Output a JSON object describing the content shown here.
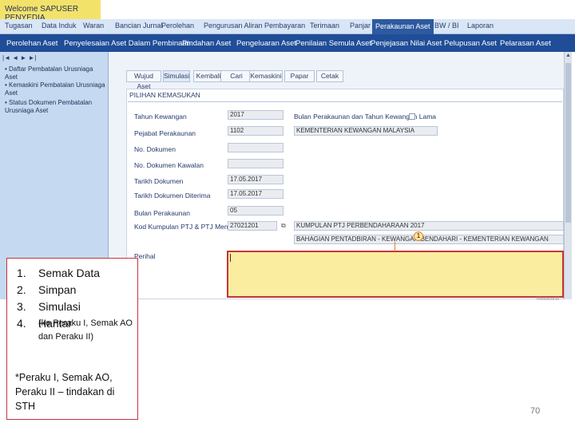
{
  "app": {
    "welcome": "Welcome SAPUSER PENYEDIA"
  },
  "menu": [
    "Tugasan",
    "Data Induk",
    "Waran",
    "Bancian Jurnal",
    "Perolehan",
    "Pengurusan Aliran Pembayaran",
    "Terimaan",
    "Panjar",
    "Perakaunan Aset",
    "BW / BI",
    "Laporan"
  ],
  "submenu": [
    "Perolehan Aset",
    "Penyelesaian Aset Dalam Pembinaan",
    "Pindahan Aset",
    "Pengeluaran Aset",
    "Penilaian Semula Aset",
    "Penjejasan Nilai Aset",
    "Pelupusan Aset",
    "Pelarasan Aset"
  ],
  "sidebar": {
    "controls": "|◄ ◄ ► ►|",
    "links": [
      "Daftar Pembatalan Urusniaga Aset",
      "Kemaskini Pembatalan Urusniaga Aset",
      "Status Dokumen Pembatalan Urusniaga Aset"
    ]
  },
  "tabs": [
    "Wujud Aset",
    "Simulasi",
    "Kembali",
    "Cari",
    "Kemaskini",
    "Papar",
    "Cetak"
  ],
  "panel": {
    "title": "PILIHAN KEMASUKAN",
    "fields": {
      "tahun_kewangan": {
        "label": "Tahun Kewangan",
        "value": "2017"
      },
      "pejabat": {
        "label": "Pejabat Perakaunan",
        "value": "1102",
        "desc": "KEMENTERIAN KEWANGAN MALAYSIA"
      },
      "no_dokumen": {
        "label": "No. Dokumen",
        "value": ""
      },
      "no_dok_kawalan": {
        "label": "No. Dokumen Kawalan",
        "value": ""
      },
      "tarikh_dokumen": {
        "label": "Tarikh Dokumen",
        "value": "17.05.2017"
      },
      "tarikh_diterima": {
        "label": "Tarikh Dokumen Diterima",
        "value": "17.05.2017"
      },
      "bulan_perakaunan": {
        "label": "Bulan Perakaunan",
        "value": "05"
      },
      "kod_kumpulan": {
        "label": "Kod Kumpulan PTJ & PTJ Menyedia",
        "value": "27021201",
        "desc1": "KUMPULAN PTJ PERBENDAHARAAN 2017",
        "desc2": "BAHAGIAN PENTADBIRAN - KEWANGAN BENDAHARI - KEMENTERIAN KEWANGAN"
      },
      "perihal": {
        "label": "Perihal",
        "value": ""
      },
      "bulan_tahun_lama": {
        "label": "Bulan Perakaunan dan Tahun Kewangan Lama"
      }
    },
    "marker": "1"
  },
  "notes": {
    "items": [
      {
        "num": "1.",
        "text": "Semak Data"
      },
      {
        "num": "2.",
        "text": "Simpan"
      },
      {
        "num": "3.",
        "text": "Simulasi"
      },
      {
        "num": "4.",
        "text": "Hantar"
      }
    ],
    "item4_sub": "(ke Peraku I, Semak AO dan Peraku II)",
    "footer": "*Peraku I, Semak AO, Peraku II – tindakan di STH"
  },
  "watermark": "Mukasurat",
  "page_number": "70"
}
